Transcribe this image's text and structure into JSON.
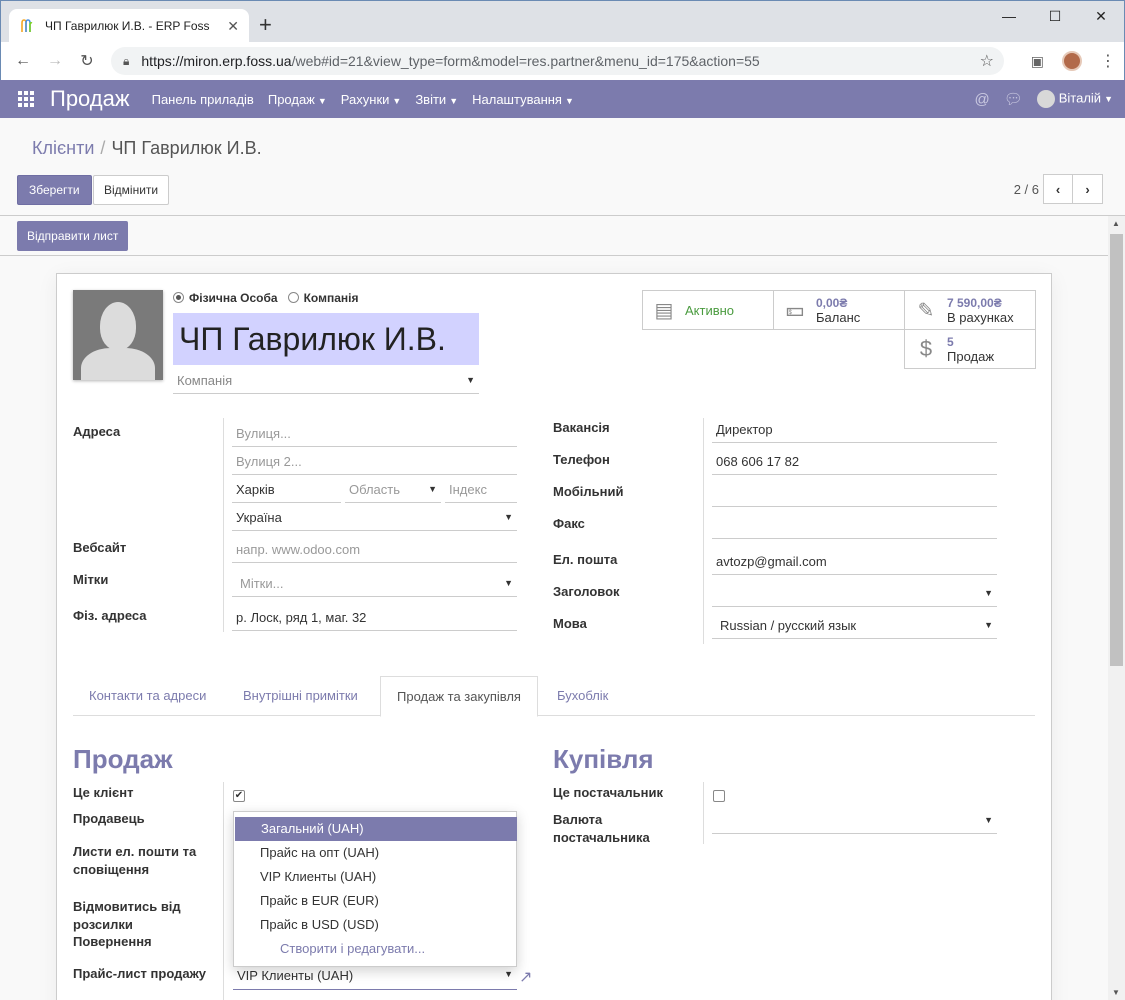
{
  "browser": {
    "tab_title": "ЧП Гаврилюк И.В. - ERP Foss",
    "url_host": "https://miron.erp.foss.ua",
    "url_rest": "/web#id=21&view_type=form&model=res.partner&menu_id=175&action=55"
  },
  "navbar": {
    "brand": "Продаж",
    "menu": [
      {
        "label": "Панель приладів",
        "caret": false
      },
      {
        "label": "Продаж",
        "caret": true
      },
      {
        "label": "Рахунки",
        "caret": true
      },
      {
        "label": "Звіти",
        "caret": true
      },
      {
        "label": "Налаштування",
        "caret": true
      }
    ],
    "user": "Віталій"
  },
  "control": {
    "breadcrumb_parent": "Клієнти",
    "breadcrumb_current": "ЧП Гаврилюк И.В.",
    "save": "Зберегти",
    "discard": "Відмінити",
    "pager": "2 / 6"
  },
  "header": {
    "send": "Відправити лист"
  },
  "partner": {
    "type_person": "Фізична Особа",
    "type_company": "Компанія",
    "name": "ЧП Гаврилюк И.В.",
    "company_placeholder": "Компанія"
  },
  "stats": {
    "active": "Активно",
    "balance_val": "0,00₴",
    "balance_lbl": "Баланс",
    "invoiced_val": "7 590,00₴",
    "invoiced_lbl": "В рахунках",
    "sales_val": "5",
    "sales_lbl": "Продаж"
  },
  "left_fields": {
    "address_lbl": "Адреса",
    "street_ph": "Вулиця...",
    "street2_ph": "Вулиця 2...",
    "city": "Харків",
    "state_ph": "Область",
    "zip_ph": "Індекс",
    "country": "Україна",
    "website_lbl": "Вебсайт",
    "website_ph": "напр. www.odoo.com",
    "tags_lbl": "Мітки",
    "tags_ph": "Мітки...",
    "phys_addr_lbl": "Фіз. адреса",
    "phys_addr": "р. Лоск, ряд 1, маг. 32"
  },
  "right_fields": {
    "job_lbl": "Вакансія",
    "job": "Директор",
    "phone_lbl": "Телефон",
    "phone": "068 606 17 82",
    "mobile_lbl": "Мобільний",
    "fax_lbl": "Факс",
    "email_lbl": "Ел. пошта",
    "email": "avtozp@gmail.com",
    "title_lbl": "Заголовок",
    "lang_lbl": "Мова",
    "lang": "Russian / русский язык"
  },
  "tabs": [
    "Контакти та адреси",
    "Внутрішні примітки",
    "Продаж та закупівля",
    "Бухоблік"
  ],
  "sales": {
    "title": "Продаж",
    "customer_lbl": "Це клієнт",
    "salesperson_lbl": "Продавець",
    "mail_lbl": "Листи ел. пошти та сповіщення",
    "optout_lbl": "Відмовитись від розсилки",
    "returns_lbl": "Повернення",
    "pricelist_lbl": "Прайс-лист продажу",
    "pricelist_value": "VIP Клиенты (UAH)",
    "customer_checked": true
  },
  "purchase": {
    "title": "Купівля",
    "supplier_lbl": "Це постачальник",
    "currency_lbl": "Валюта постачальника",
    "supplier_checked": false
  },
  "pricelist_dropdown": {
    "options": [
      "Загальний (UAH)",
      "Прайс на опт (UAH)",
      "VIP Клиенты (UAH)",
      "Прайс в EUR (EUR)",
      "Прайс в USD (USD)"
    ],
    "selected_index": 0,
    "create_label": "Створити і редагувати..."
  },
  "colors": {
    "brand": "#7c7bad",
    "name_highlight": "#d2d2ff",
    "active_green": "#4a9b3f"
  }
}
